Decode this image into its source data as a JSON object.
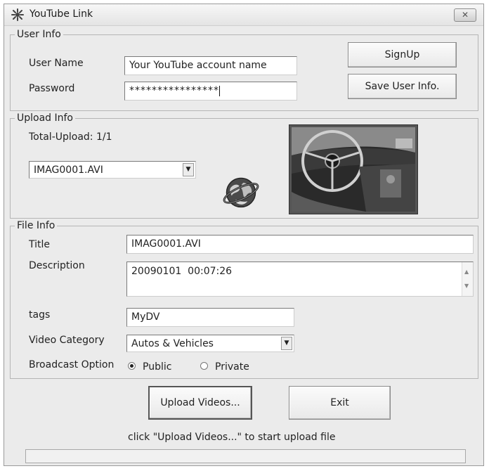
{
  "window": {
    "title": "YouTube Link",
    "close_icon": "x-icon"
  },
  "user_info": {
    "legend": "User Info",
    "username_label": "User Name",
    "username_value": "Your YouTube account name",
    "password_label": "Password",
    "password_value": "****************",
    "signup_label": "SignUp",
    "save_label": "Save User Info."
  },
  "upload_info": {
    "legend": "Upload Info",
    "total_label": "Total-Upload: 1/1",
    "file_selected": "IMAG0001.AVI",
    "globe_icon": "globe-upload-icon",
    "thumbnail": "video-thumbnail-car-interior"
  },
  "file_info": {
    "legend": "File Info",
    "title_label": "Title",
    "title_value": "IMAG0001.AVI",
    "description_label": "Description",
    "description_value": "20090101  00:07:26",
    "tags_label": "tags",
    "tags_value": "MyDV",
    "category_label": "Video Category",
    "category_value": "Autos & Vehicles",
    "broadcast_label": "Broadcast Option",
    "option_public": "Public",
    "option_private": "Private",
    "selected_option": "Public"
  },
  "actions": {
    "upload_label": "Upload Videos...",
    "exit_label": "Exit"
  },
  "status": {
    "message": "click \"Upload Videos...\" to start  upload file",
    "progress": 0
  }
}
